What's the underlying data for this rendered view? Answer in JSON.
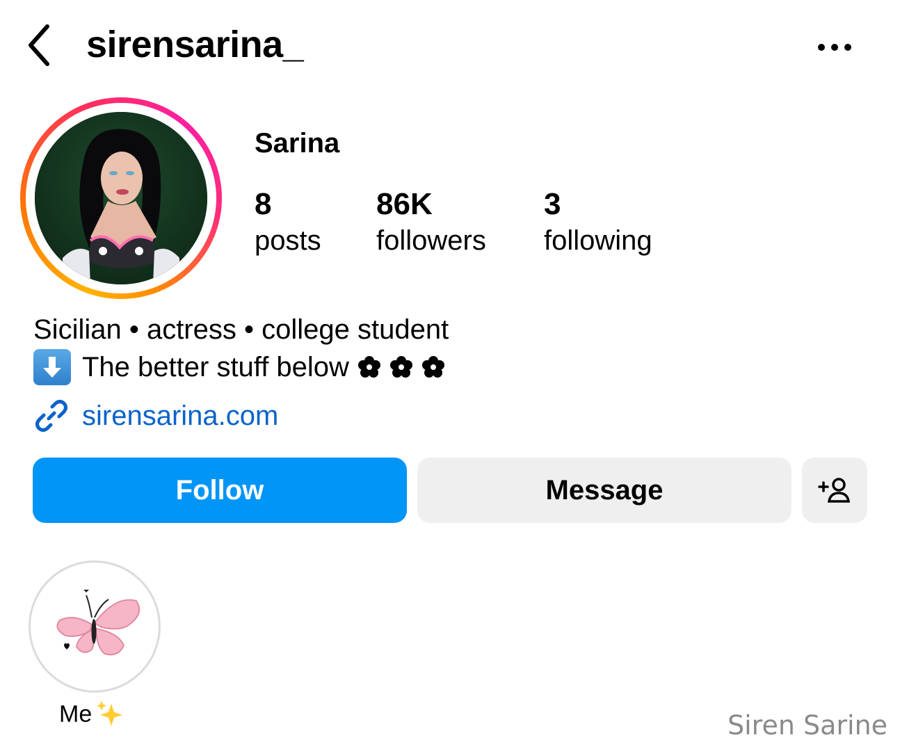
{
  "header": {
    "username": "sirensarina_",
    "back_icon": "chevron-left-icon",
    "more_icon": "ellipsis-icon"
  },
  "profile": {
    "display_name": "Sarina",
    "avatar": "profile-photo",
    "story_ring_colors": [
      "#ffb300",
      "#ff7a00",
      "#ff2f5e",
      "#ff1fa0"
    ]
  },
  "stats": {
    "posts": {
      "value": "8",
      "label": "posts"
    },
    "followers": {
      "value": "86K",
      "label": "followers"
    },
    "following": {
      "value": "3",
      "label": "following"
    }
  },
  "bio": {
    "line1": "Sicilian • actress • college student",
    "line2_text": "The better stuff below",
    "line2_lead_emoji": "down-arrow-emoji",
    "line2_trailing_icons": [
      "flower-icon",
      "flower-icon",
      "flower-icon"
    ]
  },
  "link": {
    "text": "sirensarina.com",
    "icon": "link-icon",
    "color": "#0a63c9"
  },
  "actions": {
    "follow_label": "Follow",
    "message_label": "Message",
    "suggest_icon": "add-person-icon",
    "follow_color": "#0095f6",
    "secondary_color": "#efefef"
  },
  "highlights": [
    {
      "label": "Me",
      "icon": "butterfly-icon",
      "label_emoji": "sparkles-emoji"
    }
  ],
  "watermark": "Siren Sarine"
}
